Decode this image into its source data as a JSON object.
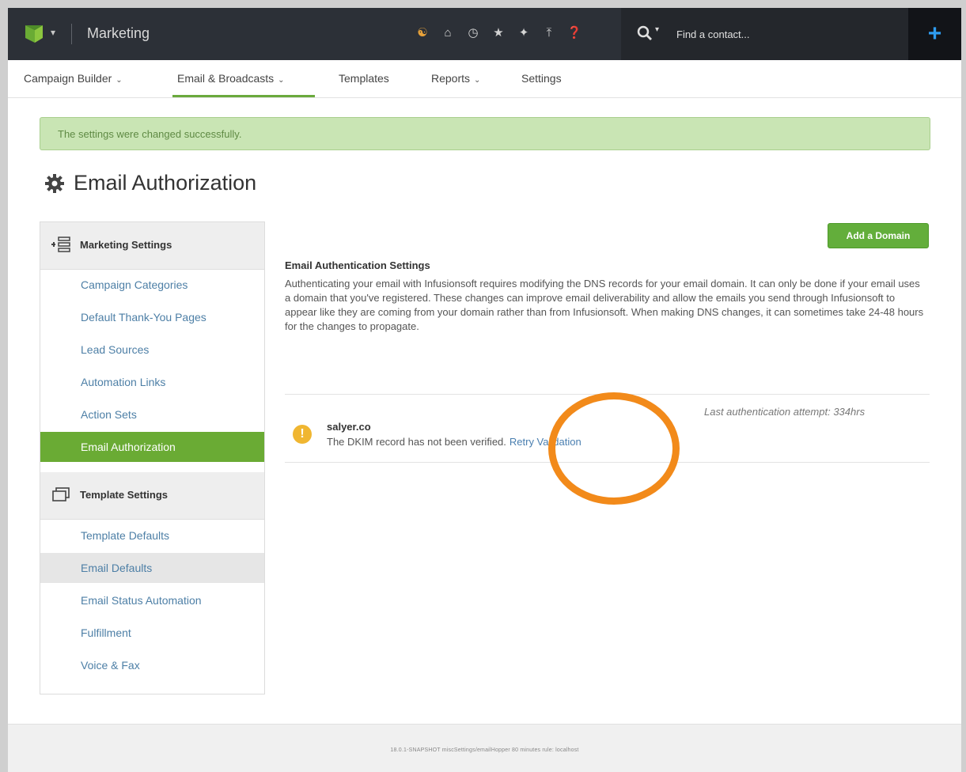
{
  "header": {
    "app_title": "Marketing",
    "icons": [
      "people-icon",
      "home-icon",
      "clock-icon",
      "star-icon",
      "sparkle-icon",
      "upload-icon",
      "help-icon"
    ],
    "search": {
      "placeholder": "Find a contact..."
    }
  },
  "nav": {
    "items": [
      {
        "label": "Campaign Builder",
        "has_dropdown": true
      },
      {
        "label": "Email & Broadcasts",
        "has_dropdown": true,
        "active": true
      },
      {
        "label": "Templates",
        "has_dropdown": false
      },
      {
        "label": "Reports",
        "has_dropdown": true
      },
      {
        "label": "Settings",
        "has_dropdown": false
      }
    ]
  },
  "alert": {
    "message": "The settings were changed successfully."
  },
  "page": {
    "title": "Email Authorization"
  },
  "sidebar": {
    "marketing_settings": {
      "label": "Marketing Settings",
      "items": [
        {
          "label": "Campaign Categories"
        },
        {
          "label": "Default Thank-You Pages"
        },
        {
          "label": "Lead Sources"
        },
        {
          "label": "Automation Links"
        },
        {
          "label": "Action Sets"
        },
        {
          "label": "Email Authorization",
          "active": true
        }
      ]
    },
    "template_settings": {
      "label": "Template Settings",
      "items": [
        {
          "label": "Template Defaults"
        },
        {
          "label": "Email Defaults",
          "hover": true
        },
        {
          "label": "Email Status Automation"
        },
        {
          "label": "Fulfillment"
        },
        {
          "label": "Voice & Fax"
        }
      ]
    }
  },
  "main": {
    "add_domain_label": "Add a Domain",
    "section_title": "Email Authentication Settings",
    "description": "Authenticating your email with Infusionsoft requires modifying the DNS records for your email domain. It can only be done if your email uses a domain that you've registered. These changes can improve email deliverability and allow the emails you send through Infusionsoft to appear like they are coming from your domain rather than from Infusionsoft. When making DNS changes, it can sometimes take 24-48 hours for the changes to propagate.",
    "domain": {
      "name": "salyer.co",
      "status_message": "The DKIM record has not been verified.",
      "retry_label": "Retry Validation",
      "last_attempt": "Last authentication attempt: 334hrs"
    }
  },
  "footer": {
    "text": "18.0.1-SNAPSHOT   miscSettings/emailHopper   80 minutes   rule: localhost"
  },
  "colors": {
    "topbar": "#2c3037",
    "accent_green": "#6aab34",
    "link_blue": "#4d7fa6",
    "alert_bg": "#c9e5b4",
    "warning": "#f0b631",
    "highlight_orange": "#f28a1a",
    "plus_blue": "#2e9cf0"
  }
}
